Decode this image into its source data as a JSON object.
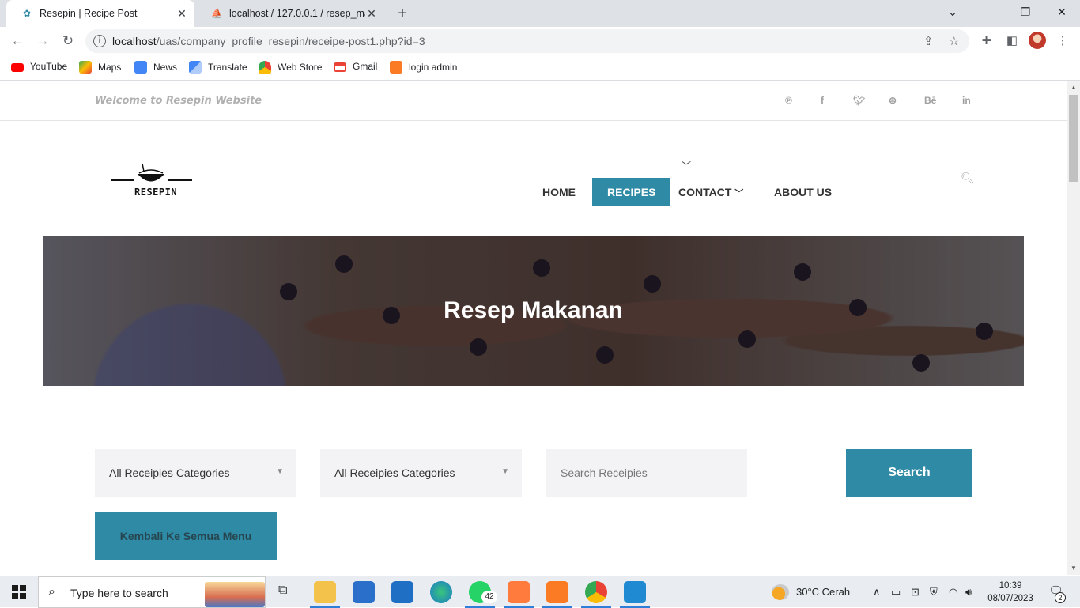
{
  "browser": {
    "tabs": [
      {
        "title": "Resepin | Recipe Post",
        "active": true
      },
      {
        "title": "localhost / 127.0.0.1 / resep_mak",
        "active": false
      }
    ],
    "url_host": "localhost",
    "url_path": "/uas/company_profile_resepin/receipe-post1.php?id=3",
    "bookmarks": [
      "YouTube",
      "Maps",
      "News",
      "Translate",
      "Web Store",
      "Gmail",
      "login admin"
    ]
  },
  "site": {
    "welcome": "Welcome to Resepin Website",
    "social_icons": [
      "pinterest-icon",
      "facebook-icon",
      "twitter-icon",
      "dribbble-icon",
      "behance-icon",
      "linkedin-icon"
    ],
    "behance_text": "Bē",
    "linkedin_text": "in",
    "logo_text": "RESEPIN",
    "nav": {
      "home": "Home",
      "recipes": "Recipes",
      "contact": "Contact",
      "about": "About Us"
    },
    "hero_title": "Resep Makanan",
    "filter1": "All Receipies Categories",
    "filter2": "All Receipies Categories",
    "search_placeholder": "Search Receipies",
    "search_button": "Search",
    "back_button": "Kembali Ke Semua Menu",
    "accent_color": "#2f8aa5"
  },
  "taskbar": {
    "search_placeholder": "Type here to search",
    "whatsapp_badge": "42",
    "weather": "30°C  Cerah",
    "time": "10:39",
    "date": "08/07/2023",
    "notifications": "2"
  }
}
